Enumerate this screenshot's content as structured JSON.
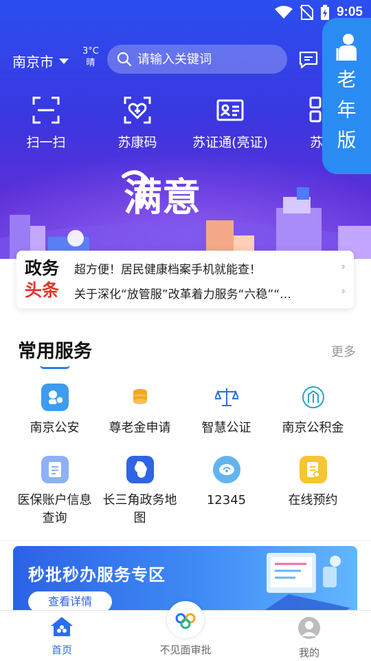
{
  "status_bar": {
    "time": "9:05"
  },
  "header": {
    "city": "南京市",
    "weather_temp": "3°C",
    "weather_desc": "晴",
    "search_placeholder": "请输入关键词",
    "elder_mode_label": [
      "老",
      "年",
      "版"
    ]
  },
  "quick_actions": [
    {
      "label": "扫一扫",
      "icon": "scan-icon"
    },
    {
      "label": "苏康码",
      "icon": "health-code-icon"
    },
    {
      "label": "苏证通(亮证)",
      "icon": "id-card-icon"
    },
    {
      "label": "苏服",
      "icon": "grid-icon"
    }
  ],
  "banner": {
    "headline": "满意"
  },
  "news": {
    "tag_line1": "政务",
    "tag_line2": "头条",
    "items": [
      "超方便！居民健康档案手机就能查！",
      "关于深化“放管服”改革着力服务“六稳”“…"
    ]
  },
  "services": {
    "title": "常用服务",
    "more": "更多",
    "items": [
      {
        "label": "南京公安",
        "icon": "police-icon",
        "color": "#3d9bf0"
      },
      {
        "label": "尊老金申请",
        "icon": "coins-icon",
        "color": "#f2a623"
      },
      {
        "label": "智慧公证",
        "icon": "scales-icon",
        "color": "#2d6fd8"
      },
      {
        "label": "南京公积金",
        "icon": "building-fund-icon",
        "color": "#2aa3c9"
      },
      {
        "label": "医保账户信息查询",
        "icon": "insurance-doc-icon",
        "color": "#7ea6f5"
      },
      {
        "label": "长三角政务地图",
        "icon": "region-map-icon",
        "color": "#2f64e6"
      },
      {
        "label": "12345",
        "icon": "hotline-icon",
        "color": "#62b4ef"
      },
      {
        "label": "在线预约",
        "icon": "appointment-icon",
        "color": "#f7c531"
      }
    ]
  },
  "promo": {
    "title": "秒批秒办服务专区",
    "button": "查看详情"
  },
  "bottom_nav": {
    "home": "首页",
    "center": "不见面审批",
    "mine": "我的",
    "active_color": "#2a6df0"
  }
}
